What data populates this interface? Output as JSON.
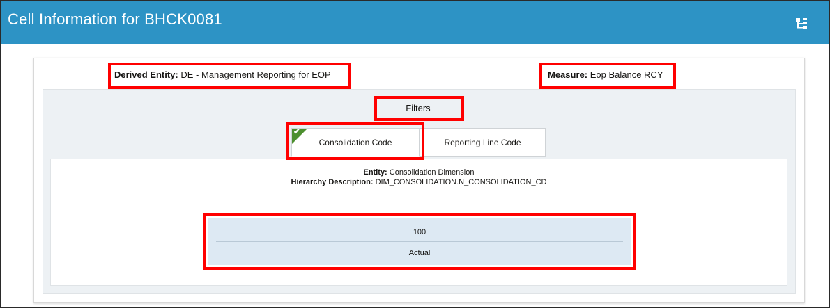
{
  "header": {
    "title": "Cell Information for BHCK0081",
    "hierarchy_icon": "hierarchy-icon",
    "color": "#2d93c5"
  },
  "info": {
    "derived_entity_label": "Derived Entity:",
    "derived_entity_value": "DE - Management Reporting for EOP",
    "measure_label": "Measure:",
    "measure_value": "Eop Balance RCY"
  },
  "filters": {
    "title": "Filters",
    "tabs": [
      {
        "label": "Consolidation Code",
        "active": true,
        "status_icon": "checkmark-icon"
      },
      {
        "label": "Reporting Line Code",
        "active": false
      }
    ],
    "entity_label": "Entity:",
    "entity_value": "Consolidation Dimension",
    "hierarchy_label": "Hierarchy Description:",
    "hierarchy_value": "DIM_CONSOLIDATION.N_CONSOLIDATION_CD",
    "values": [
      "100",
      "Actual"
    ]
  },
  "colors": {
    "highlight": "#ff0000",
    "check_badge": "#4c8f2f",
    "value_table_bg": "#dde9f3"
  }
}
